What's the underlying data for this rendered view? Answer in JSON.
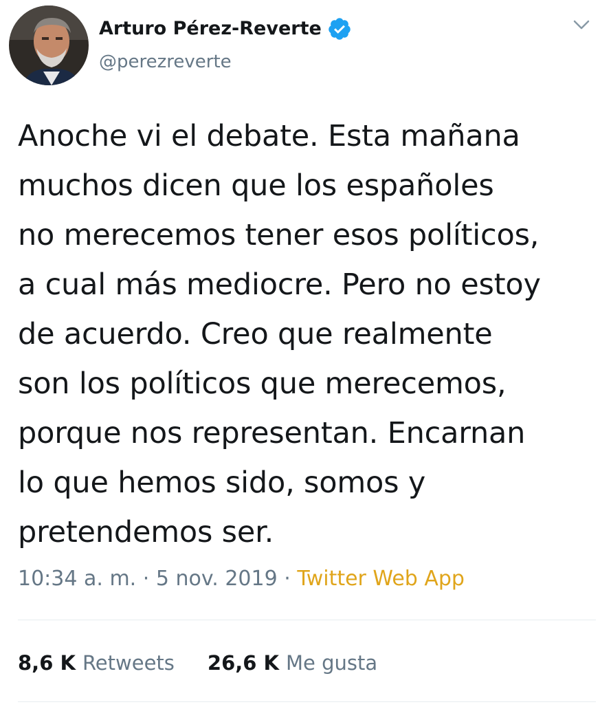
{
  "author": {
    "display_name": "Arturo Pérez-Reverte",
    "handle": "@perezreverte",
    "verified": true,
    "avatar_icon": "profile-photo"
  },
  "tweet": {
    "text": "Anoche vi el debate. Esta mañana\nmuchos dicen que los españoles\nno merecemos tener esos políticos,\na cual más mediocre. Pero no estoy\nde acuerdo. Creo que realmente\nson los políticos que merecemos,\nporque nos representan. Encarnan\nlo que hemos sido, somos y\npretendemos ser."
  },
  "meta": {
    "time": "10:34 a. m.",
    "separator": "·",
    "date": "5 nov. 2019",
    "source": "Twitter Web App"
  },
  "stats": {
    "retweets_count": "8,6 K",
    "retweets_label": "Retweets",
    "likes_count": "26,6 K",
    "likes_label": "Me gusta"
  },
  "colors": {
    "text": "#14171a",
    "secondary": "#657786",
    "source_link": "#e0a51b",
    "verified_badge": "#1da1f2",
    "divider": "#e6ecf0"
  },
  "icons": {
    "verified": "verified-badge-icon",
    "menu": "chevron-down-icon"
  }
}
